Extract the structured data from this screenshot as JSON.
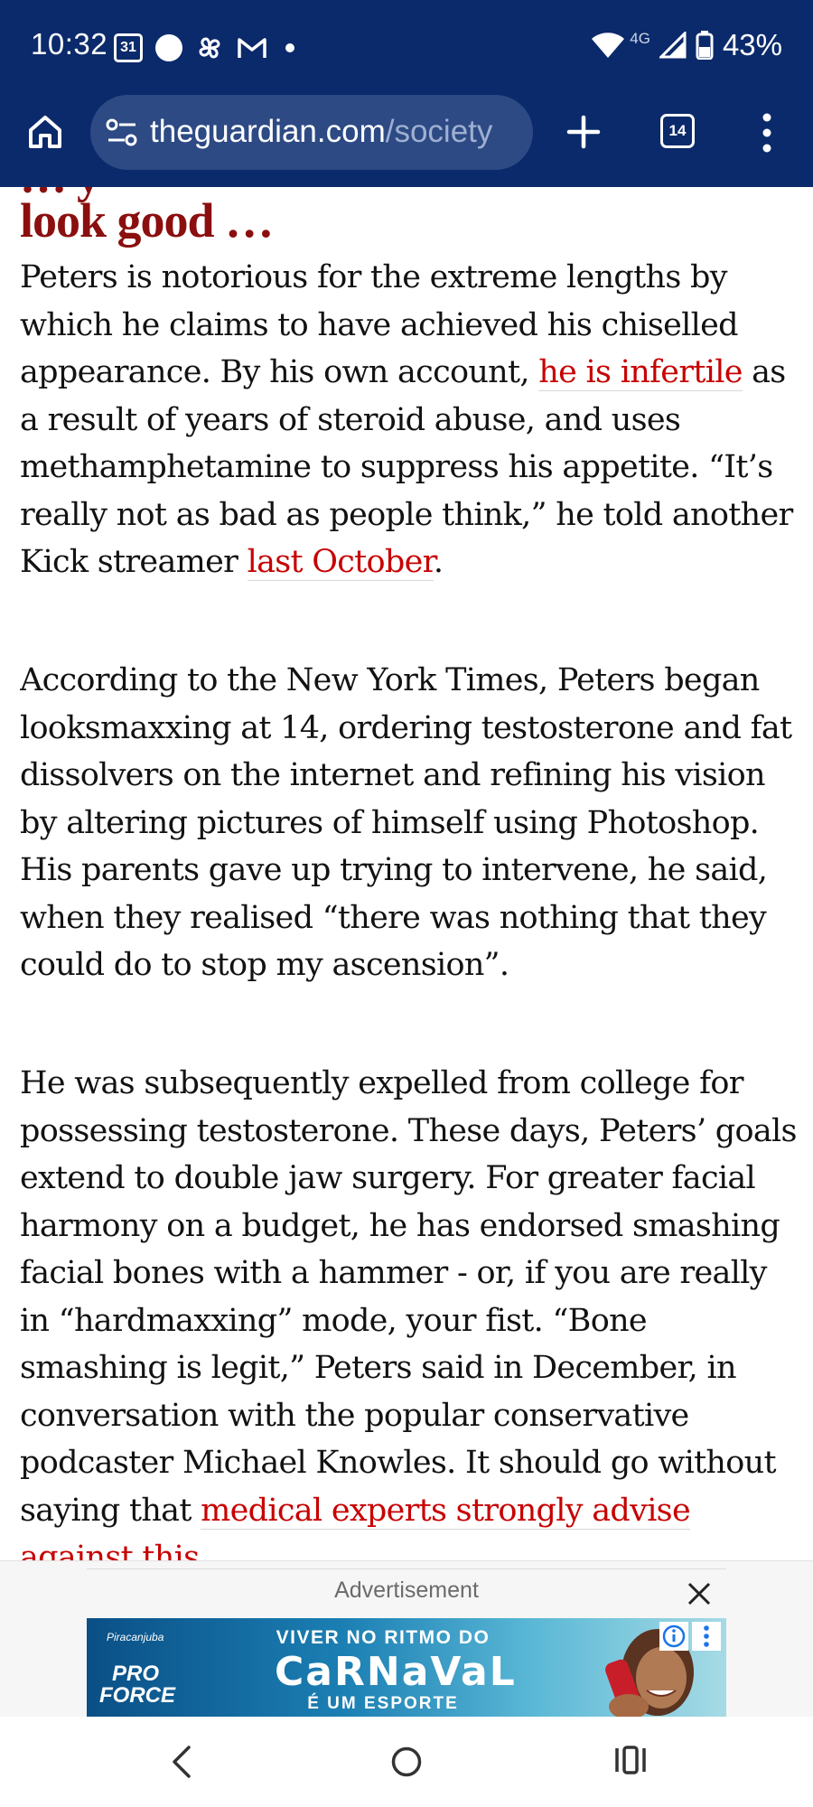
{
  "status_bar": {
    "time": "10:32",
    "calendar_day": "31",
    "network": "4G",
    "battery": "43%",
    "icons": [
      "calendar-icon",
      "circle-icon",
      "pinwheel-icon",
      "gmail-icon",
      "dot-icon",
      "wifi-icon",
      "signal-icon",
      "battery-icon"
    ]
  },
  "browser": {
    "url_domain": "theguardian.com",
    "url_path": "/society",
    "tab_count": "14",
    "icons": [
      "home-icon",
      "site-settings-icon",
      "plus-icon",
      "tabs-icon",
      "more-vert-icon"
    ]
  },
  "article": {
    "heading_top_fragment": "… y",
    "heading": "look good …",
    "paragraphs": [
      {
        "before": "Peters is notorious for the extreme lengths by which he claims to have achieved his chiselled appearance. By his own account, ",
        "link1": "he is infertile",
        "middle": " as a result of years of steroid abuse, and uses methamphetamine to suppress his appetite. “It’s really not as bad as people think,” he told another Kick streamer ",
        "link2": "last October",
        "after": "."
      },
      {
        "text": "According to the New York Times, Peters began looksmaxxing at 14, ordering testosterone and fat dissolvers on the internet and refining his vision by altering pictures of himself using Photoshop. His parents gave up trying to intervene, he said, when they realised “there was nothing that they could do to stop my ascension”."
      },
      {
        "before": "He was subsequently expelled from college for possessing testosterone. These days, Peters’ goals extend to double jaw surgery. For greater facial harmony on a budget, he has endorsed smashing facial bones with a hammer - or, if you are really in “hardmaxxing” mode, your fist. “Bone smashing is legit,” Peters said in December, in conversation with the popular conservative podcaster Michael Knowles. It should go without saying that ",
        "link": "medical experts strongly advise against this",
        "after": "."
      }
    ]
  },
  "ad": {
    "label": "Advertisement",
    "brand_top": "Piracanjuba",
    "brand_logo_line1": "PRO",
    "brand_logo_line2": "FORCE",
    "line1": "VIVER NO RITMO DO",
    "line2": "CaRNaVaL",
    "line3": "É UM ESPORTE"
  },
  "nav": {
    "icons": [
      "back-icon",
      "home-circle-icon",
      "recents-icon"
    ]
  },
  "colors": {
    "chrome_bg": "#0b2a6b",
    "url_pill": "#2d4a85",
    "headline_red": "#8b0f0f",
    "link_red": "#c70000",
    "body_text": "#121212"
  }
}
